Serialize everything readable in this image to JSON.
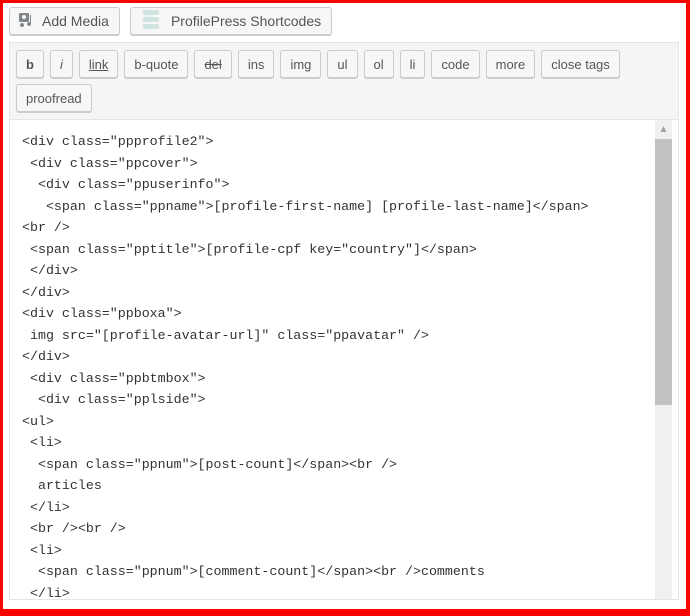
{
  "media_buttons": [
    {
      "label": "Add Media",
      "icon": "add-media-icon"
    },
    {
      "label": "ProfilePress Shortcodes",
      "icon": "profilepress-icon"
    }
  ],
  "quicktags": [
    "b",
    "i",
    "link",
    "b-quote",
    "del",
    "ins",
    "img",
    "ul",
    "ol",
    "li",
    "code",
    "more",
    "close tags",
    "proofread"
  ],
  "code_lines": [
    "<div class=\"ppprofile2\">",
    " <div class=\"ppcover\">",
    "  <div class=\"ppuserinfo\">",
    "   <span class=\"ppname\">[profile-first-name] [profile-last-name]</span>",
    "<br />",
    " <span class=\"pptitle\">[profile-cpf key=\"country\"]</span>",
    " </div>",
    "</div>",
    "<div class=\"ppboxa\">",
    " img src=\"[profile-avatar-url]\" class=\"ppavatar\" />",
    "</div>",
    " <div class=\"ppbtmbox\">",
    "  <div class=\"pplside\">",
    "<ul>",
    " <li>",
    "  <span class=\"ppnum\">[post-count]</span><br />",
    "  articles",
    " </li>",
    " <br /><br />",
    " <li>",
    "  <span class=\"ppnum\">[comment-count]</span><br />comments",
    " </li>"
  ],
  "colors": {
    "highlight_border": "#ff0000"
  }
}
